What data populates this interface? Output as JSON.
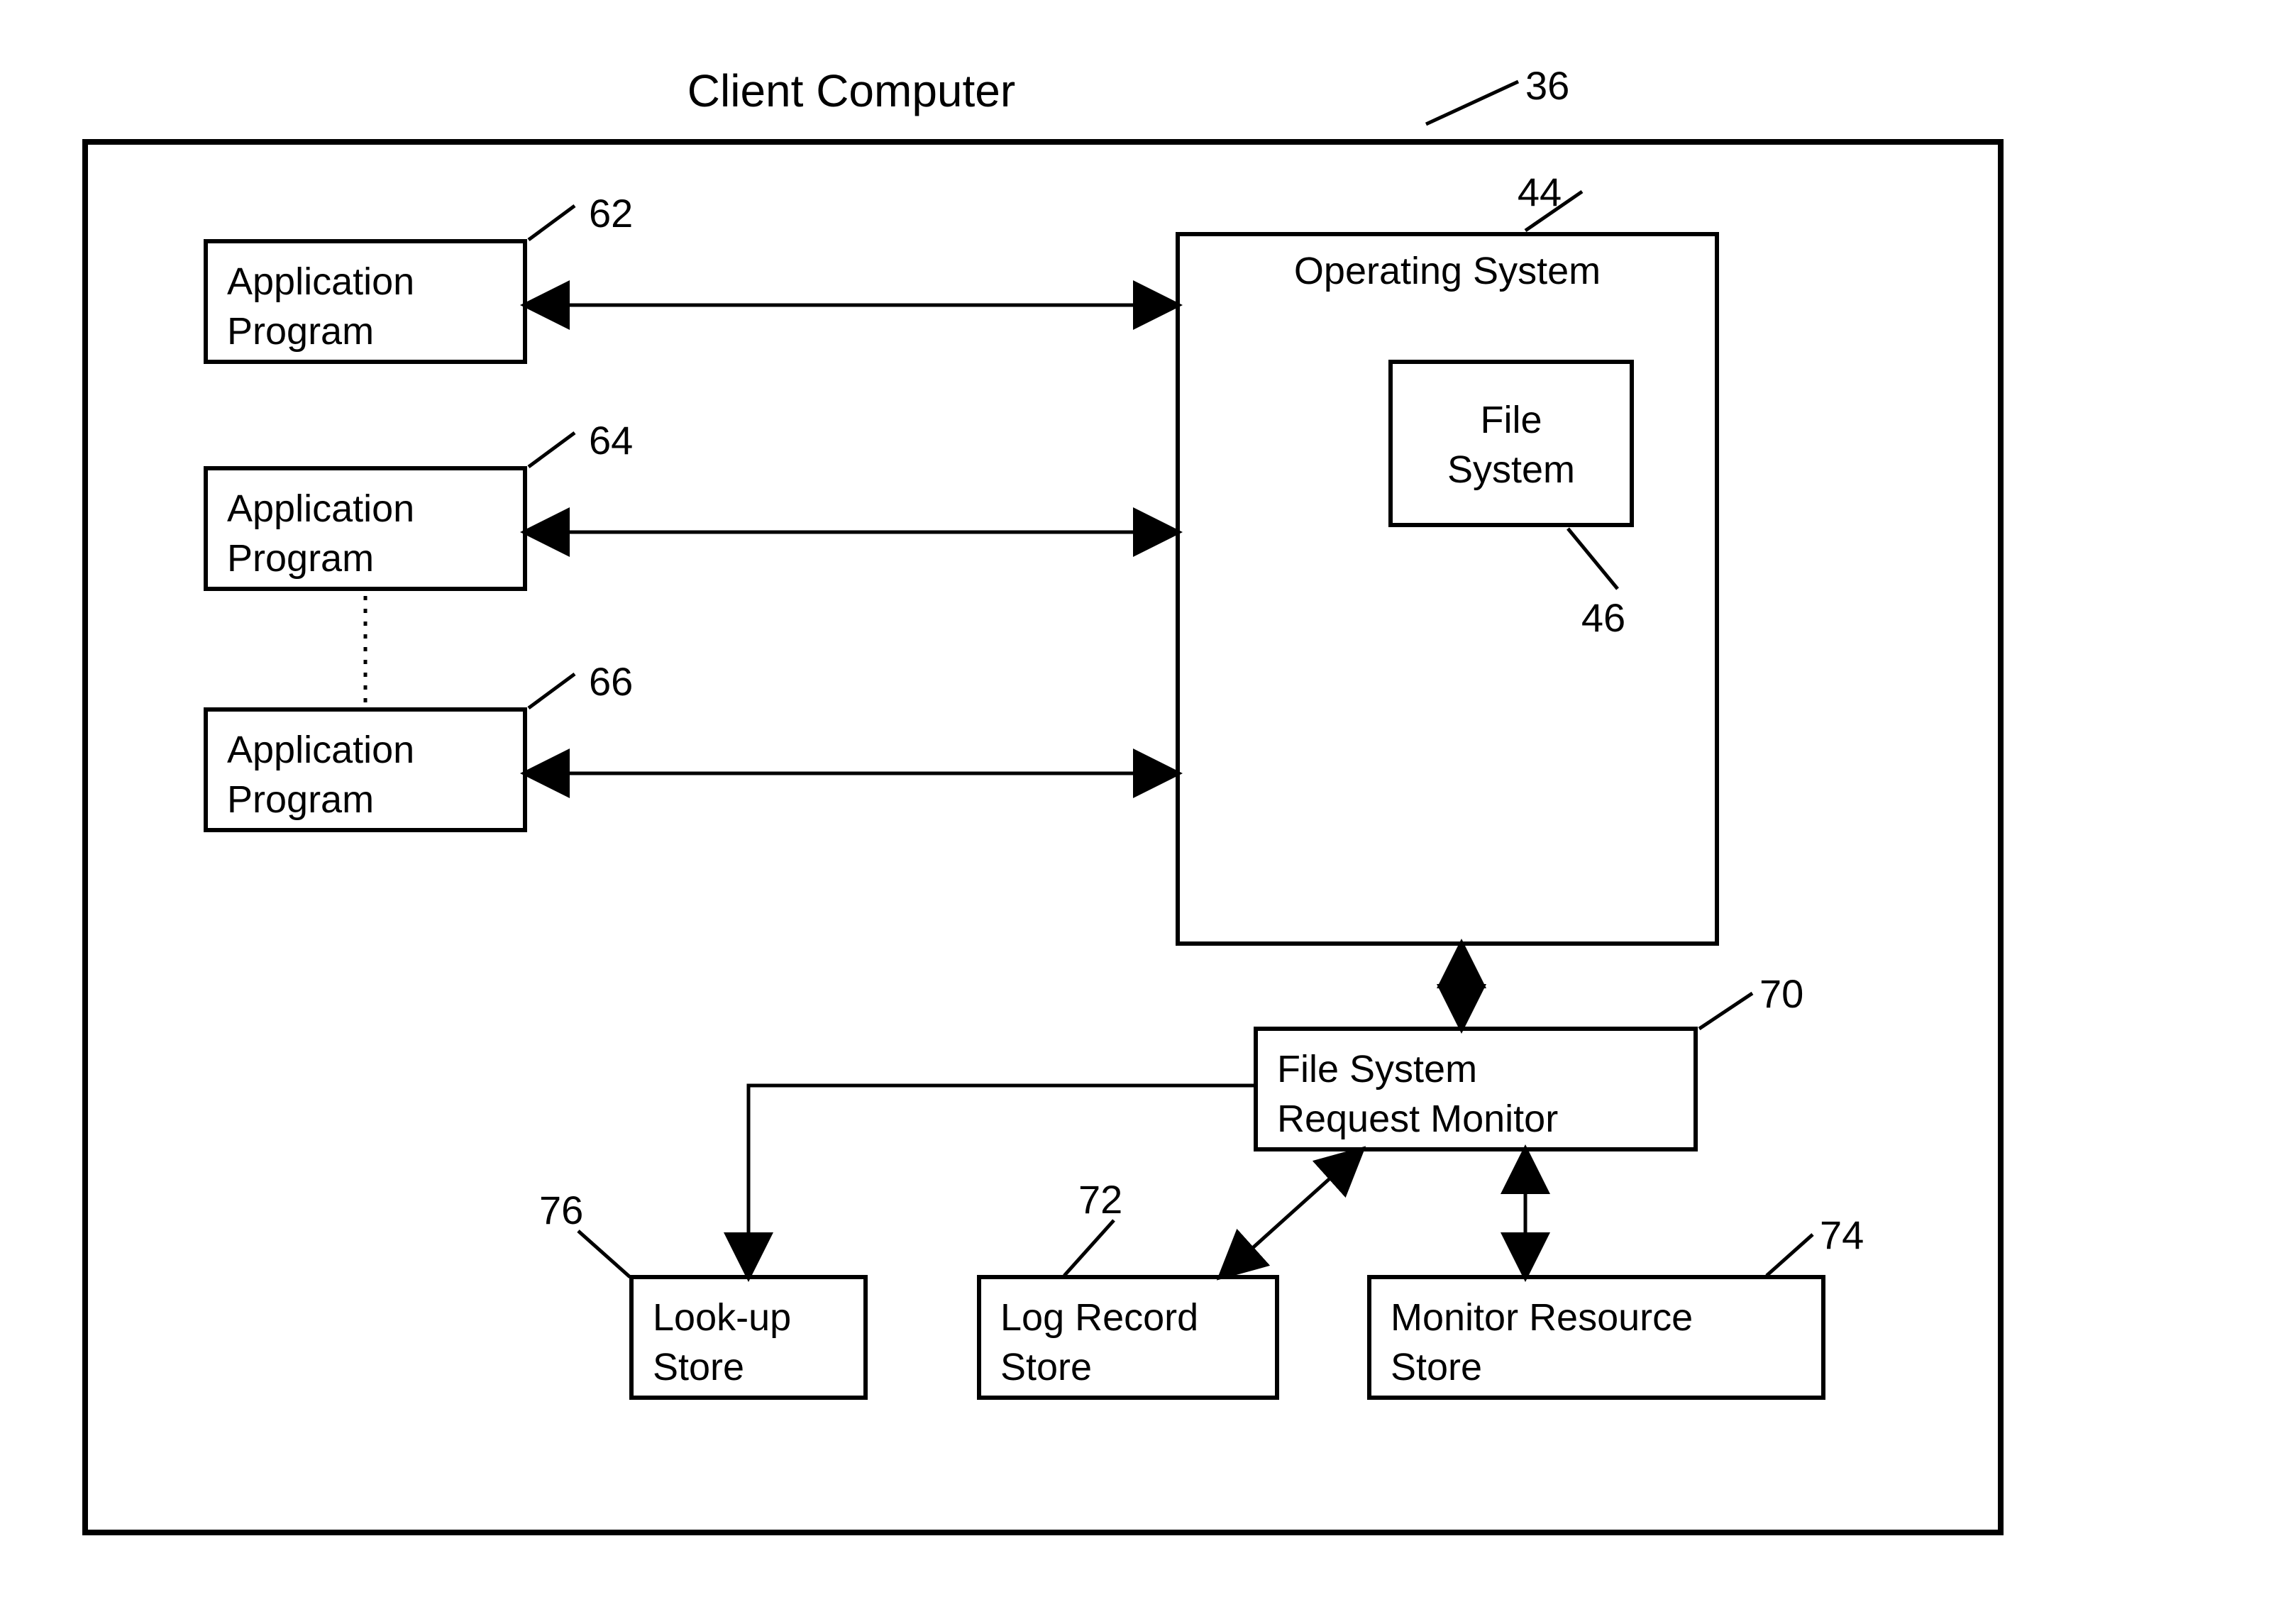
{
  "title": "Client Computer",
  "refs": {
    "outer": "36",
    "app1": "62",
    "app2": "64",
    "app3": "66",
    "os": "44",
    "fs": "46",
    "monitor": "70",
    "log": "72",
    "resource": "74",
    "lookup": "76"
  },
  "boxes": {
    "app1": {
      "l1": "Application",
      "l2": "Program"
    },
    "app2": {
      "l1": "Application",
      "l2": "Program"
    },
    "app3": {
      "l1": "Application",
      "l2": "Program"
    },
    "os": {
      "l1": "Operating System"
    },
    "fs": {
      "l1": "File",
      "l2": "System"
    },
    "monitor": {
      "l1": "File System",
      "l2": "Request Monitor"
    },
    "log": {
      "l1": "Log Record",
      "l2": "Store"
    },
    "resource": {
      "l1": "Monitor Resource",
      "l2": "Store"
    },
    "lookup": {
      "l1": "Look-up",
      "l2": "Store"
    }
  }
}
